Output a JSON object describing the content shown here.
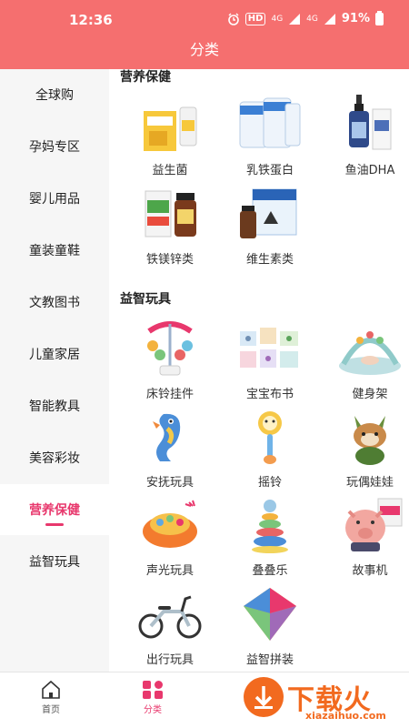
{
  "status_bar": {
    "time": "12:36",
    "hd_label": "HD",
    "network_1": "4G",
    "network_2": "4G",
    "battery": "91%"
  },
  "page_title": "分类",
  "sidebar": {
    "items": [
      {
        "label": "全球购"
      },
      {
        "label": "孕妈专区"
      },
      {
        "label": "婴儿用品"
      },
      {
        "label": "童装童鞋"
      },
      {
        "label": "文教图书"
      },
      {
        "label": "儿童家居"
      },
      {
        "label": "智能教具"
      },
      {
        "label": "美容彩妆"
      },
      {
        "label": "营养保健",
        "active": true
      },
      {
        "label": "益智玩具"
      }
    ]
  },
  "sections": [
    {
      "title": "营养保健",
      "items": [
        {
          "label": "益生菌",
          "icon": "probiotic-box"
        },
        {
          "label": "乳铁蛋白",
          "icon": "milk-powder-cans"
        },
        {
          "label": "鱼油DHA",
          "icon": "dropper-bottle"
        },
        {
          "label": "铁镁锌类",
          "icon": "supplement-bottle"
        },
        {
          "label": "维生素类",
          "icon": "vitamin-box"
        }
      ]
    },
    {
      "title": "益智玩具",
      "items": [
        {
          "label": "床铃挂件",
          "icon": "crib-mobile"
        },
        {
          "label": "宝宝布书",
          "icon": "cloth-books"
        },
        {
          "label": "健身架",
          "icon": "play-gym"
        },
        {
          "label": "安抚玩具",
          "icon": "seahorse-toy"
        },
        {
          "label": "摇铃",
          "icon": "rattle"
        },
        {
          "label": "玩偶娃娃",
          "icon": "plush-doll"
        },
        {
          "label": "声光玩具",
          "icon": "light-sound-toy"
        },
        {
          "label": "叠叠乐",
          "icon": "stacking-rings"
        },
        {
          "label": "故事机",
          "icon": "pig-story-machine"
        },
        {
          "label": "出行玩具",
          "icon": "balance-bike"
        },
        {
          "label": "益智拼装",
          "icon": "spinning-top"
        }
      ]
    }
  ],
  "tabbar": {
    "tabs": [
      {
        "label": "首页",
        "icon": "home-icon"
      },
      {
        "label": "分类",
        "icon": "category-icon",
        "active": true
      }
    ]
  },
  "watermark": {
    "text": "下载火",
    "sub": "xiazaihuo.com"
  },
  "colors": {
    "brand": "#f56f6f",
    "accent": "#e8386d",
    "sidebar_bg": "#f6f6f6",
    "watermark": "#f26a1f"
  }
}
